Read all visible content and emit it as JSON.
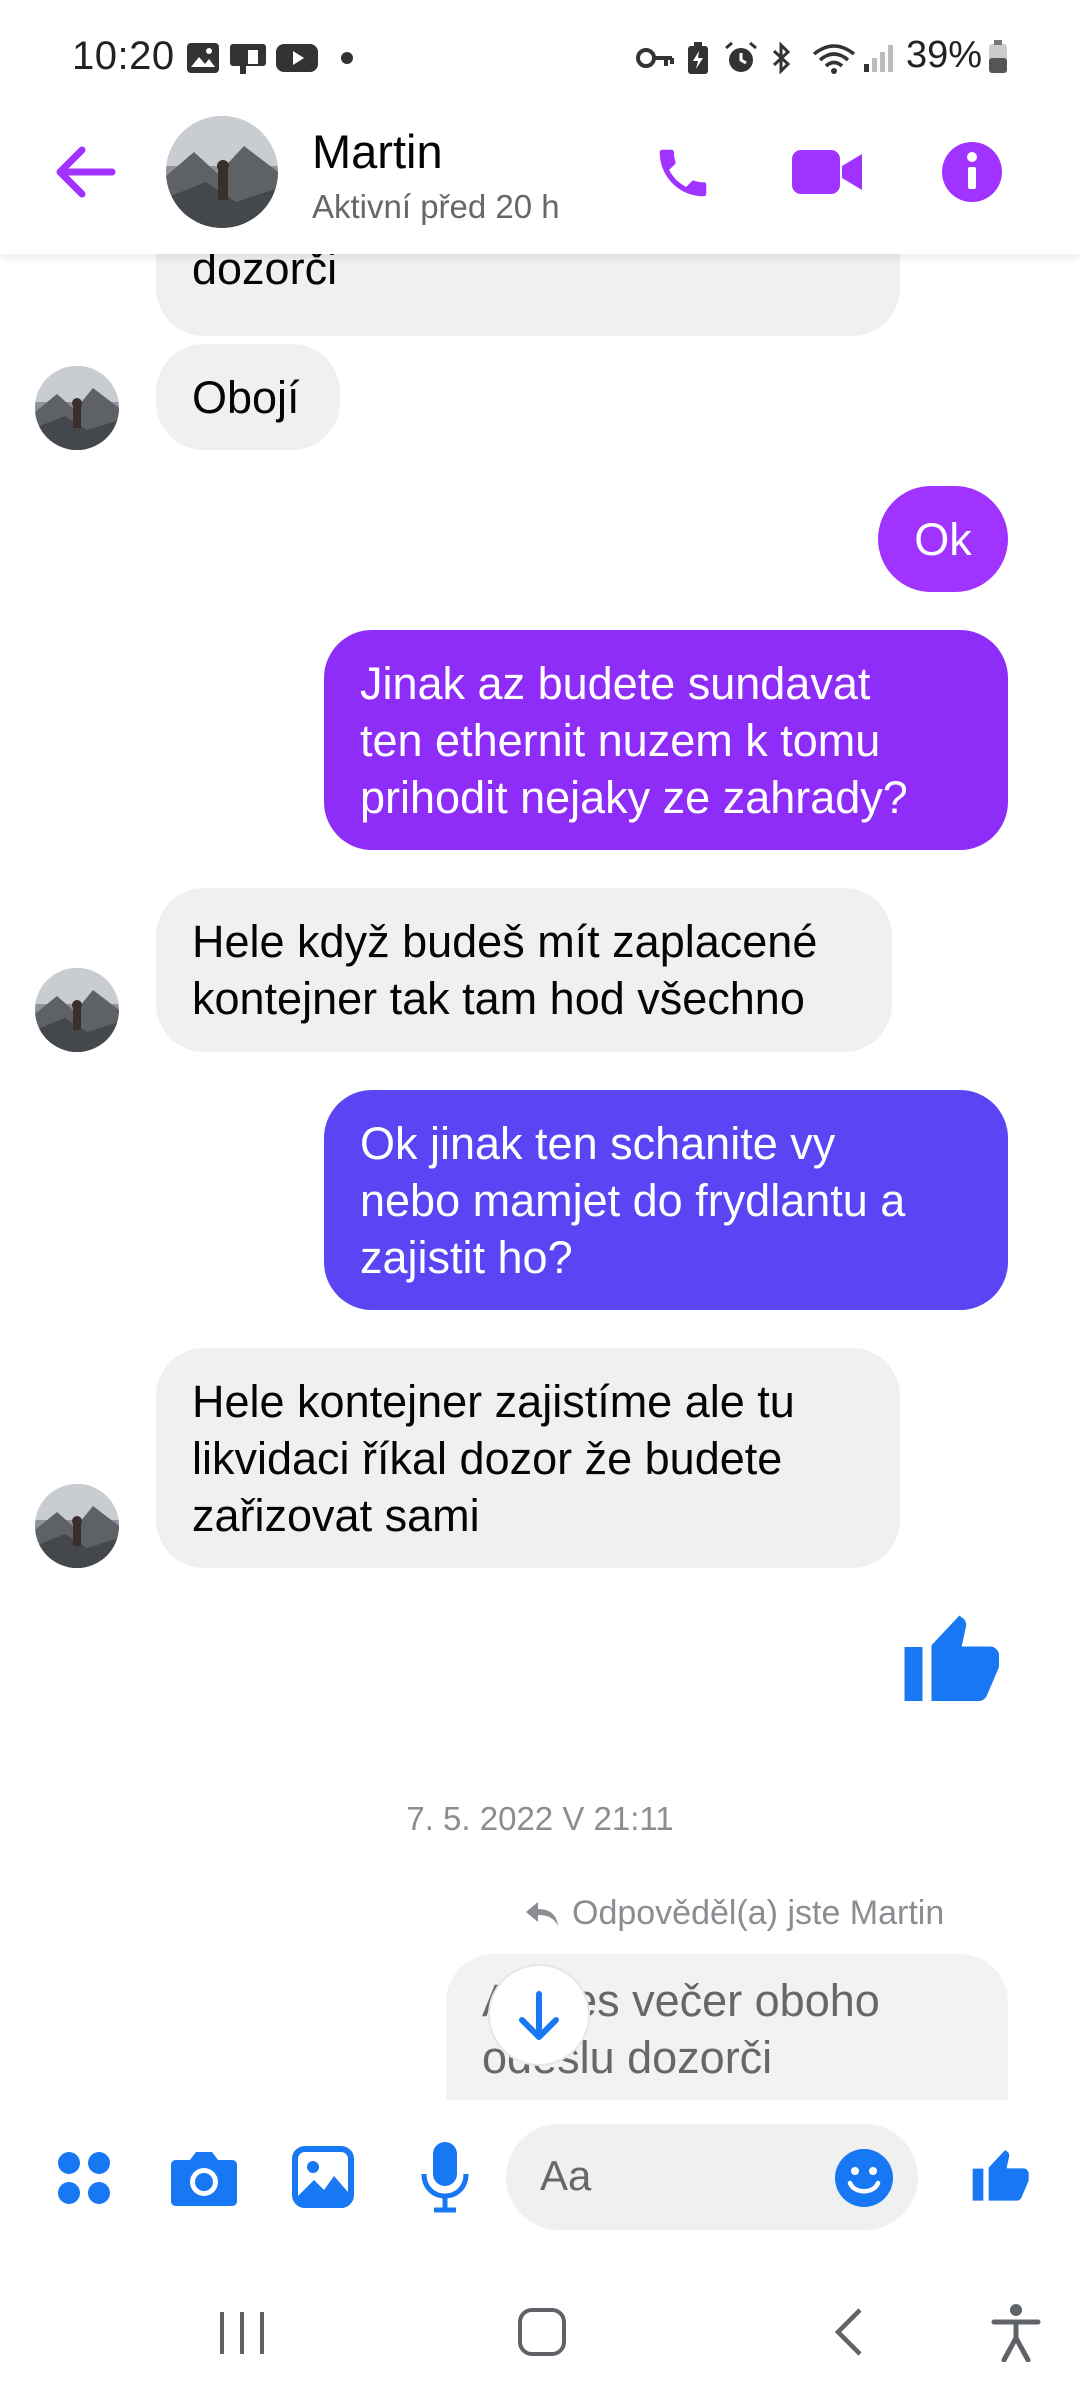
{
  "status_bar": {
    "time": "10:20",
    "battery": "39%",
    "icons": [
      "gallery-icon",
      "cast-icon",
      "youtube-icon",
      "dot-icon",
      "vpn-key-icon",
      "battery-saver-icon",
      "alarm-icon",
      "bluetooth-icon",
      "wifi-icon",
      "signal-icon"
    ]
  },
  "header": {
    "name": "Martin",
    "status": "Aktivní před 20 h"
  },
  "messages": {
    "m0": "dozorči",
    "m1": "Obojí",
    "m2": "Ok",
    "m3": "Jinak az budete sundavat\nten ethernit nuzem k tomu\nprihodit nejaky ze zahrady?",
    "m4": "Hele když budeš mít zaplacené\nkontejner tak tam hod všechno",
    "m5": "Ok jinak ten schanite vy\nnebo mamjet do frydlantu a\nzajistit ho?",
    "m6": "Hele kontejner zajistíme ale tu\nlikvidaci říkal dozor že budete\nzařizovat sami",
    "m7": "A dnes večer oboho\nodeslu dozorči"
  },
  "date_separator": "7. 5. 2022 V 21:11",
  "reply_note": "Odpověděl(a) jste Martin",
  "composer": {
    "placeholder": "Aa"
  },
  "colors": {
    "accent": "#a033ff",
    "blue": "#1877f2",
    "bubble_in": "#f0f0f0"
  }
}
